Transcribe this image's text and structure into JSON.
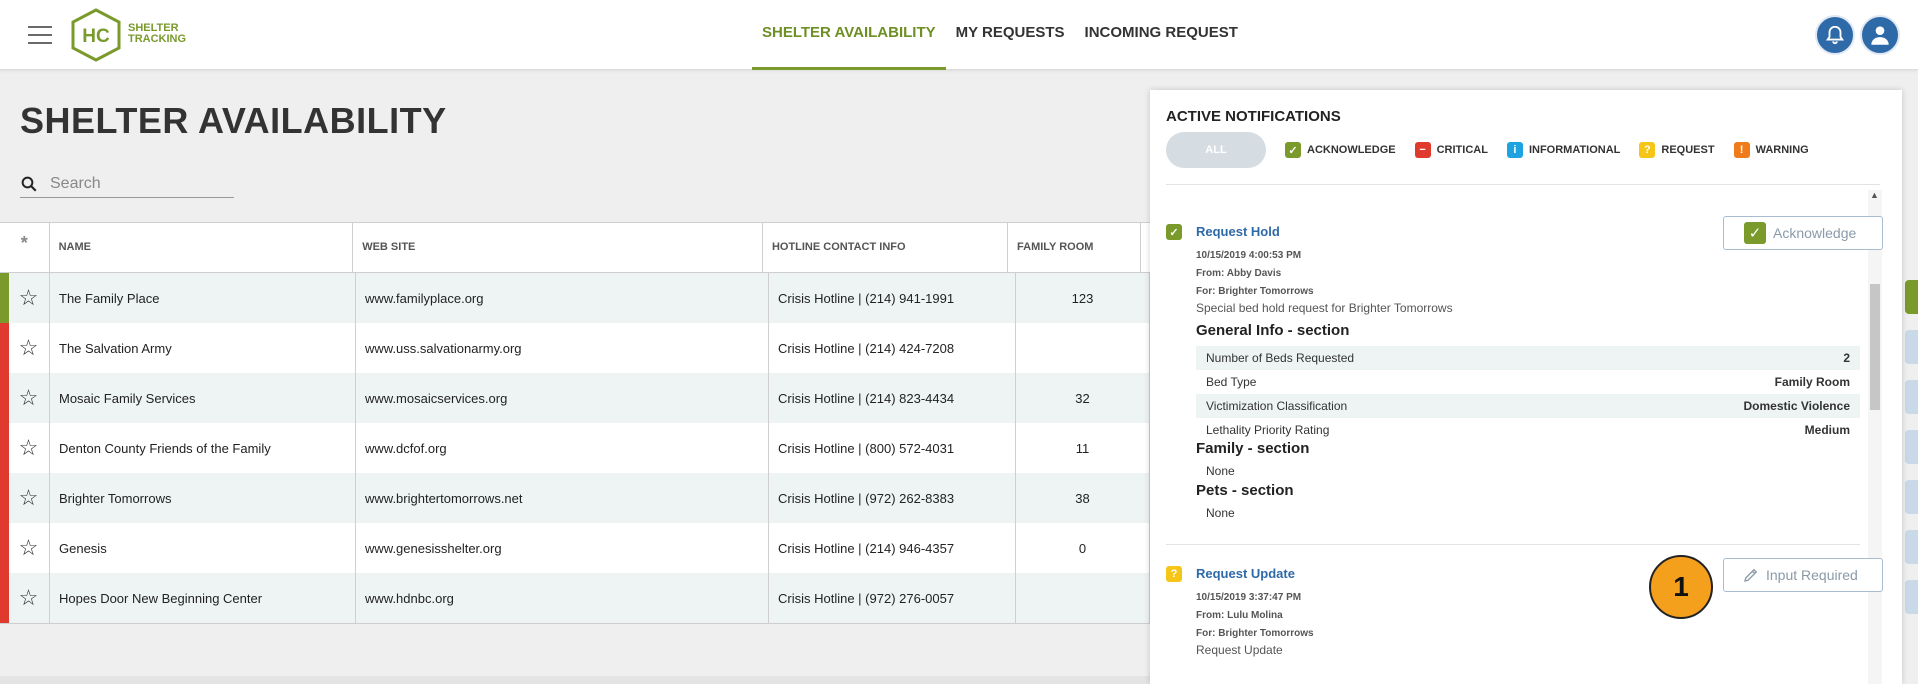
{
  "header": {
    "logo_text_line1": "SHELTER",
    "logo_text_line2": "TRACKING",
    "logo_mark": "HC",
    "nav": [
      {
        "label": "SHELTER AVAILABILITY",
        "active": true
      },
      {
        "label": "MY REQUESTS",
        "active": false
      },
      {
        "label": "INCOMING REQUEST",
        "active": false
      }
    ],
    "icons": [
      "bell-icon",
      "user-icon"
    ]
  },
  "page": {
    "title": "SHELTER AVAILABILITY",
    "search_placeholder": "Search"
  },
  "table": {
    "first_col_header": "*",
    "columns": [
      "NAME",
      "WEB SITE",
      "HOTLINE CONTACT INFO",
      "FAMILY ROOM",
      "S"
    ],
    "rows": [
      {
        "status": "green",
        "name": "The Family Place",
        "website": "www.familyplace.org",
        "hotline": "Crisis Hotline | (214) 941-1991",
        "family_room": "123"
      },
      {
        "status": "red",
        "name": "The Salvation Army",
        "website": "www.uss.salvationarmy.org",
        "hotline": "Crisis Hotline | (214) 424-7208",
        "family_room": ""
      },
      {
        "status": "red",
        "name": "Mosaic Family Services",
        "website": "www.mosaicservices.org",
        "hotline": "Crisis Hotline | (214) 823-4434",
        "family_room": "32"
      },
      {
        "status": "red",
        "name": "Denton County Friends of the Family",
        "website": "www.dcfof.org",
        "hotline": "Crisis Hotline | (800) 572-4031",
        "family_room": "11"
      },
      {
        "status": "red",
        "name": "Brighter Tomorrows",
        "website": "www.brightertomorrows.net",
        "hotline": "Crisis Hotline | (972) 262-8383",
        "family_room": "38"
      },
      {
        "status": "red",
        "name": "Genesis",
        "website": "www.genesisshelter.org",
        "hotline": "Crisis Hotline | (214) 946-4357",
        "family_room": "0"
      },
      {
        "status": "red",
        "name": "Hopes Door New Beginning Center",
        "website": "www.hdnbc.org",
        "hotline": "Crisis Hotline | (972) 276-0057",
        "family_room": ""
      }
    ]
  },
  "notifications": {
    "title": "ACTIVE NOTIFICATIONS",
    "filter_all": "ALL",
    "filters": [
      {
        "label": "ACKNOWLEDGE",
        "color": "#7a9a2c",
        "glyph": "✓"
      },
      {
        "label": "CRITICAL",
        "color": "#e03a2f",
        "glyph": "−"
      },
      {
        "label": "INFORMATIONAL",
        "color": "#1fa3e0",
        "glyph": "i"
      },
      {
        "label": "REQUEST",
        "color": "#f5c518",
        "glyph": "?"
      },
      {
        "label": "WARNING",
        "color": "#f07b1a",
        "glyph": "!"
      }
    ],
    "items": [
      {
        "type": "acknowledge",
        "title": "Request Hold",
        "timestamp": "10/15/2019 4:00:53 PM",
        "from": "From: Abby Davis",
        "for": "For: Brighter Tomorrows",
        "description": "Special bed hold request for Brighter Tomorrows",
        "button": "Acknowledge",
        "general_section": "General Info - section",
        "general_fields": [
          {
            "label": "Number of Beds Requested",
            "value": "2"
          },
          {
            "label": "Bed Type",
            "value": "Family Room"
          },
          {
            "label": "Victimization Classification",
            "value": "Domestic Violence"
          },
          {
            "label": "Lethality Priority Rating",
            "value": "Medium"
          }
        ],
        "family_section": "Family - section",
        "family_value": "None",
        "pets_section": "Pets - section",
        "pets_value": "None"
      },
      {
        "type": "request",
        "title": "Request Update",
        "timestamp": "10/15/2019 3:37:47 PM",
        "from": "From: Lulu Molina",
        "for": "For: Brighter Tomorrows",
        "description": "Request Update",
        "button": "Input Required"
      }
    ]
  },
  "callout_number": "1",
  "colors": {
    "brand_green": "#7a9a2c",
    "status_red": "#e03a2f",
    "accent_blue": "#2f6aa8",
    "callout_orange": "#f4a01c"
  }
}
